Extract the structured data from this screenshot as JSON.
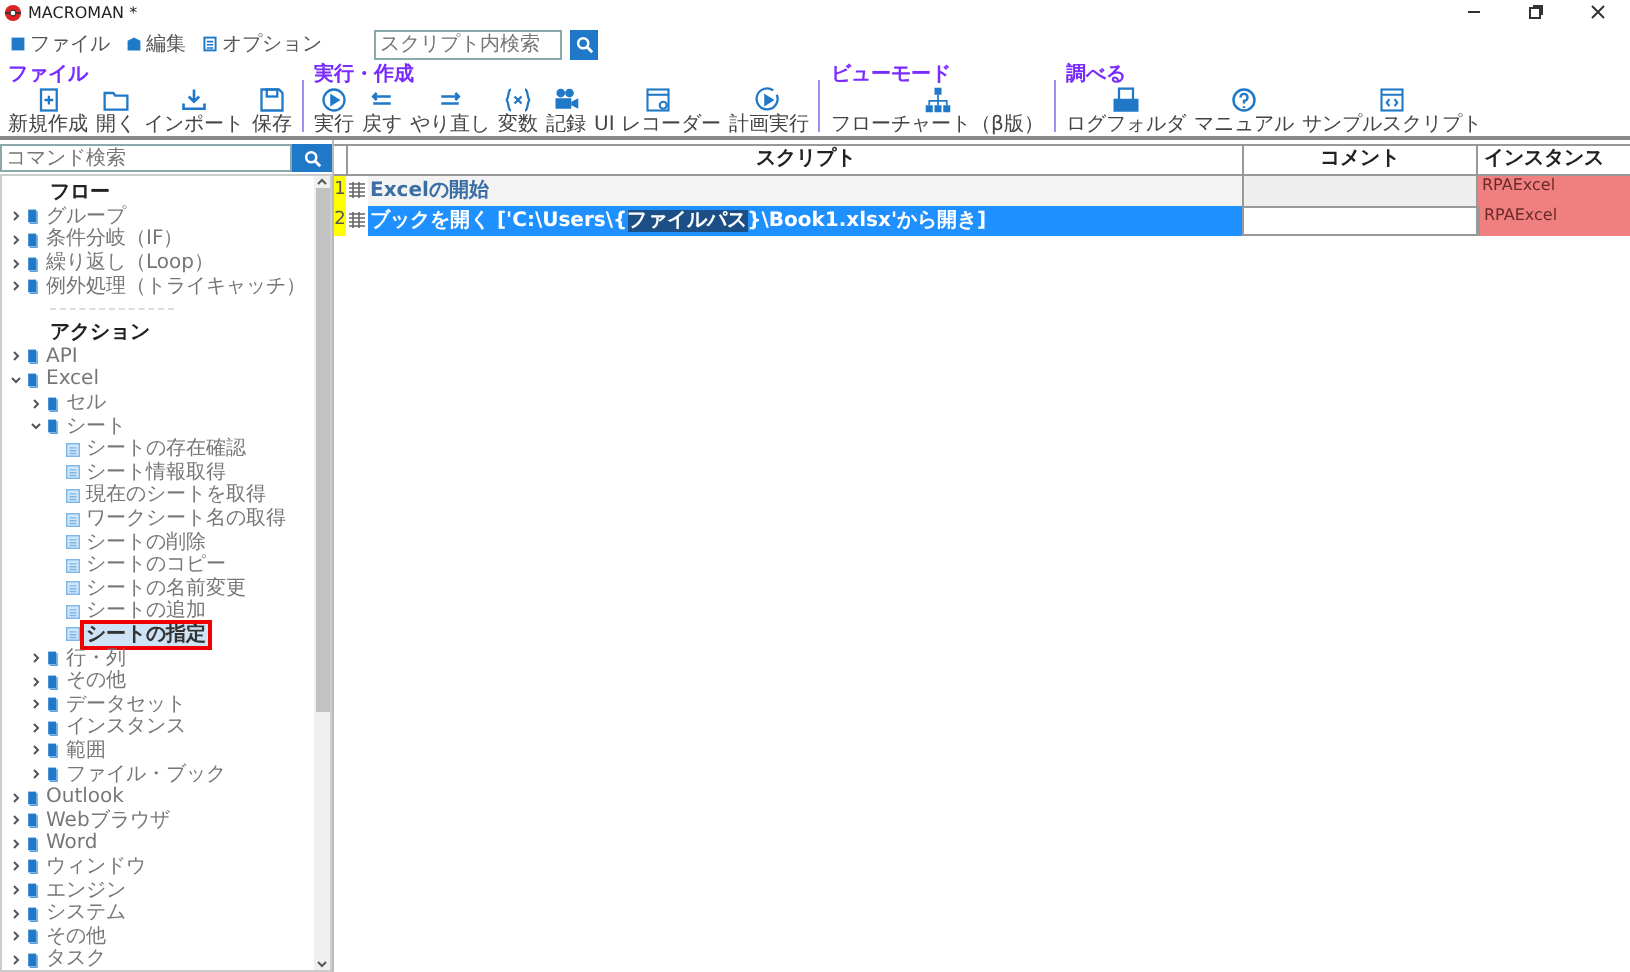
{
  "window": {
    "title": "MACROMAN *"
  },
  "menu": [
    {
      "label": "ファイル",
      "kind": "file"
    },
    {
      "label": "編集",
      "kind": "edit"
    },
    {
      "label": "オプション",
      "kind": "options"
    }
  ],
  "script_search": {
    "placeholder": "スクリプト内検索"
  },
  "toolbar": [
    {
      "label": "ファイル",
      "buttons": [
        {
          "label": "新規作成",
          "kind": "new"
        },
        {
          "label": "開く",
          "kind": "open"
        },
        {
          "label": "インポート",
          "kind": "import"
        },
        {
          "label": "保存",
          "kind": "save"
        }
      ]
    },
    {
      "label": "実行・作成",
      "buttons": [
        {
          "label": "実行",
          "kind": "run"
        },
        {
          "label": "戻す",
          "kind": "undo"
        },
        {
          "label": "やり直し",
          "kind": "redo"
        },
        {
          "label": "変数",
          "kind": "variable"
        },
        {
          "label": "記録",
          "kind": "record"
        },
        {
          "label": "UI レコーダー",
          "kind": "recorder"
        },
        {
          "label": "計画実行",
          "kind": "schedule"
        }
      ]
    },
    {
      "label": "ビューモード",
      "buttons": [
        {
          "label": "フローチャート（β版）",
          "kind": "flowchart"
        }
      ]
    },
    {
      "label": "調べる",
      "buttons": [
        {
          "label": "ログフォルダ",
          "kind": "log"
        },
        {
          "label": "マニュアル",
          "kind": "manual"
        },
        {
          "label": "サンプルスクリプト",
          "kind": "sample"
        }
      ]
    }
  ],
  "command_search": {
    "placeholder": "コマンド検索"
  },
  "flow": {
    "heading": "フロー",
    "items": [
      {
        "label": "グループ",
        "kind": "category",
        "expanded": false,
        "selected": false
      },
      {
        "label": "条件分岐（IF）",
        "kind": "category",
        "expanded": false,
        "selected": false
      },
      {
        "label": "繰り返し（Loop）",
        "kind": "category",
        "expanded": false,
        "selected": false
      },
      {
        "label": "例外処理（トライキャッチ）",
        "kind": "category",
        "expanded": false,
        "selected": false
      }
    ]
  },
  "actions": {
    "heading": "アクション",
    "items": [
      {
        "label": "API",
        "kind": "category",
        "expanded": false,
        "selected": false
      },
      {
        "label": "Excel",
        "kind": "category",
        "expanded": true,
        "selected": false,
        "children": [
          {
            "label": "セル",
            "kind": "category",
            "expanded": false,
            "selected": false
          },
          {
            "label": "シート",
            "kind": "category",
            "expanded": true,
            "selected": false,
            "children": [
              {
                "label": "シートの存在確認",
                "kind": "action",
                "selected": false
              },
              {
                "label": "シート情報取得",
                "kind": "action",
                "selected": false
              },
              {
                "label": "現在のシートを取得",
                "kind": "action",
                "selected": false
              },
              {
                "label": "ワークシート名の取得",
                "kind": "action",
                "selected": false
              },
              {
                "label": "シートの削除",
                "kind": "action",
                "selected": false
              },
              {
                "label": "シートのコピー",
                "kind": "action",
                "selected": false
              },
              {
                "label": "シートの名前変更",
                "kind": "action",
                "selected": false
              },
              {
                "label": "シートの追加",
                "kind": "action",
                "selected": false
              },
              {
                "label": "シートの指定",
                "kind": "action",
                "selected": true
              }
            ]
          },
          {
            "label": "行・列",
            "kind": "category",
            "expanded": false,
            "selected": false
          },
          {
            "label": "その他",
            "kind": "category",
            "expanded": false,
            "selected": false
          },
          {
            "label": "データセット",
            "kind": "category",
            "expanded": false,
            "selected": false
          },
          {
            "label": "インスタンス",
            "kind": "category",
            "expanded": false,
            "selected": false
          },
          {
            "label": "範囲",
            "kind": "category",
            "expanded": false,
            "selected": false
          },
          {
            "label": "ファイル・ブック",
            "kind": "category",
            "expanded": false,
            "selected": false
          }
        ]
      },
      {
        "label": "Outlook",
        "kind": "category",
        "expanded": false,
        "selected": false
      },
      {
        "label": "Webブラウザ",
        "kind": "category",
        "expanded": false,
        "selected": false
      },
      {
        "label": "Word",
        "kind": "category",
        "expanded": false,
        "selected": false
      },
      {
        "label": "ウィンドウ",
        "kind": "category",
        "expanded": false,
        "selected": false
      },
      {
        "label": "エンジン",
        "kind": "category",
        "expanded": false,
        "selected": false
      },
      {
        "label": "システム",
        "kind": "category",
        "expanded": false,
        "selected": false
      },
      {
        "label": "その他",
        "kind": "category",
        "expanded": false,
        "selected": false
      },
      {
        "label": "タスク",
        "kind": "category",
        "expanded": false,
        "selected": false
      }
    ]
  },
  "table": {
    "columns": [
      "スクリプト",
      "コメント",
      "インスタンス"
    ],
    "rows": [
      {
        "number": "1",
        "script": [
          {
            "text": "Excelの開始",
            "variable": false
          }
        ],
        "comment": "",
        "instance": "RPAExcel",
        "selected": false
      },
      {
        "number": "2",
        "script": [
          {
            "text": "ブックを開く ['C:\\Users\\{",
            "variable": false
          },
          {
            "text": "ファイルパス",
            "variable": true
          },
          {
            "text": "}\\Book1.xlsx'から開き]",
            "variable": false
          }
        ],
        "comment": "",
        "instance": "RPAExcel",
        "selected": true
      }
    ]
  }
}
